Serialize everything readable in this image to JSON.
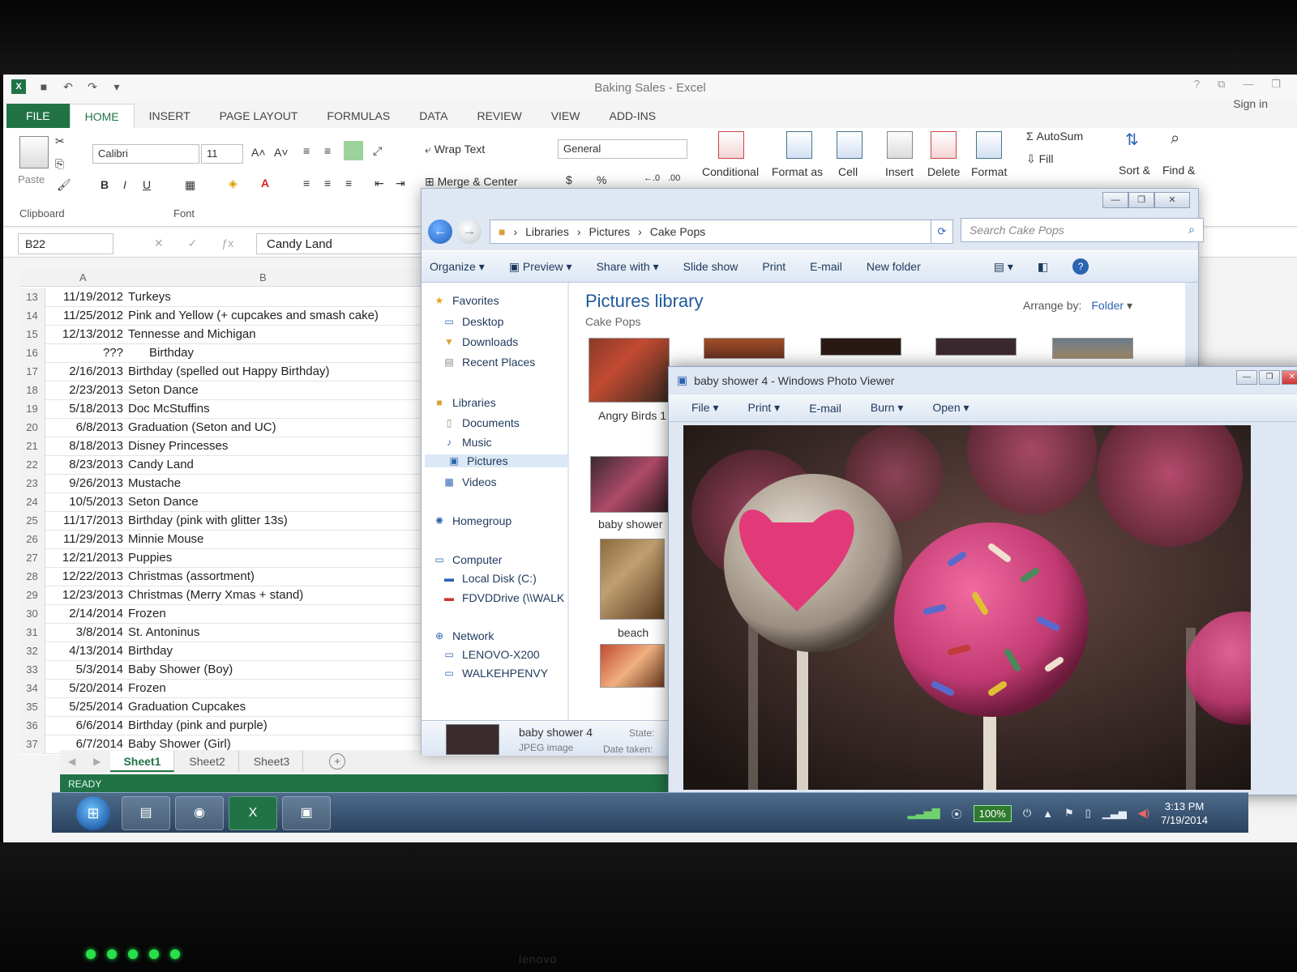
{
  "excel": {
    "title": "Baking Sales - Excel",
    "sign_in": "Sign in",
    "tabs": [
      "FILE",
      "HOME",
      "INSERT",
      "PAGE LAYOUT",
      "FORMULAS",
      "DATA",
      "REVIEW",
      "VIEW",
      "ADD-INS"
    ],
    "ribbon": {
      "paste": "Paste",
      "clipboard": "Clipboard",
      "font_group": "Font",
      "font_name": "Calibri",
      "font_size": "11",
      "bold": "B",
      "italic": "I",
      "underline": "U",
      "wrap_text": "Wrap Text",
      "merge_center": "Merge & Center",
      "number_format": "General",
      "currency": "$",
      "percent": "%",
      "conditional": "Conditional",
      "format_as": "Format as",
      "cell": "Cell",
      "insert": "Insert",
      "delete": "Delete",
      "format": "Format",
      "autosum": "AutoSum",
      "fill": "Fill",
      "sort": "Sort &",
      "find": "Find &"
    },
    "name_box": "B22",
    "formula_value": "Candy Land",
    "columns": [
      "A",
      "B"
    ],
    "rows": [
      {
        "n": "13",
        "a": "11/19/2012",
        "b": "Turkeys"
      },
      {
        "n": "14",
        "a": "11/25/2012",
        "b": "Pink and Yellow (+ cupcakes and smash cake)"
      },
      {
        "n": "15",
        "a": "12/13/2012",
        "b": "Tennesse and Michigan"
      },
      {
        "n": "16",
        "a": "???",
        "b": "Birthday"
      },
      {
        "n": "17",
        "a": "2/16/2013",
        "b": "Birthday (spelled out Happy Birthday)"
      },
      {
        "n": "18",
        "a": "2/23/2013",
        "b": "Seton Dance"
      },
      {
        "n": "19",
        "a": "5/18/2013",
        "b": "Doc McStuffins"
      },
      {
        "n": "20",
        "a": "6/8/2013",
        "b": "Graduation (Seton and UC)"
      },
      {
        "n": "21",
        "a": "8/18/2013",
        "b": "Disney Princesses"
      },
      {
        "n": "22",
        "a": "8/23/2013",
        "b": "Candy Land"
      },
      {
        "n": "23",
        "a": "9/26/2013",
        "b": "Mustache"
      },
      {
        "n": "24",
        "a": "10/5/2013",
        "b": "Seton Dance"
      },
      {
        "n": "25",
        "a": "11/17/2013",
        "b": "Birthday (pink with glitter 13s)"
      },
      {
        "n": "26",
        "a": "11/29/2013",
        "b": "Minnie Mouse"
      },
      {
        "n": "27",
        "a": "12/21/2013",
        "b": "Puppies"
      },
      {
        "n": "28",
        "a": "12/22/2013",
        "b": "Christmas (assortment)"
      },
      {
        "n": "29",
        "a": "12/23/2013",
        "b": "Christmas (Merry Xmas + stand)"
      },
      {
        "n": "30",
        "a": "2/14/2014",
        "b": "Frozen"
      },
      {
        "n": "31",
        "a": "3/8/2014",
        "b": "St. Antoninus"
      },
      {
        "n": "32",
        "a": "4/13/2014",
        "b": "Birthday"
      },
      {
        "n": "33",
        "a": "5/3/2014",
        "b": "Baby Shower (Boy)"
      },
      {
        "n": "34",
        "a": "5/20/2014",
        "b": "Frozen"
      },
      {
        "n": "35",
        "a": "5/25/2014",
        "b": "Graduation Cupcakes"
      },
      {
        "n": "36",
        "a": "6/6/2014",
        "b": "Birthday (pink and purple)"
      },
      {
        "n": "37",
        "a": "6/7/2014",
        "b": "Baby Shower (Girl)"
      }
    ],
    "sheets": [
      "Sheet1",
      "Sheet2",
      "Sheet3"
    ],
    "status": "READY"
  },
  "explorer": {
    "breadcrumb": [
      "Libraries",
      "Pictures",
      "Cake Pops"
    ],
    "search_placeholder": "Search Cake Pops",
    "commands": [
      "Organize",
      "Preview",
      "Share with",
      "Slide show",
      "Print",
      "E-mail",
      "New folder"
    ],
    "nav": {
      "favorites": "Favorites",
      "desktop": "Desktop",
      "downloads": "Downloads",
      "recent": "Recent Places",
      "libraries": "Libraries",
      "documents": "Documents",
      "music": "Music",
      "pictures": "Pictures",
      "videos": "Videos",
      "homegroup": "Homegroup",
      "computer": "Computer",
      "local_disk": "Local Disk (C:)",
      "fdvd": "FDVDDrive (\\\\WALK",
      "network": "Network",
      "lenovo": "LENOVO-X200",
      "walkeh": "WALKEHPENVY"
    },
    "library_title": "Pictures library",
    "library_sub": "Cake Pops",
    "arrange_label": "Arrange by:",
    "arrange_value": "Folder",
    "thumbs": [
      "Angry Birds 1",
      "baby shower",
      "beach"
    ],
    "details": {
      "name": "baby shower 4",
      "type": "JPEG image",
      "state": "State:",
      "date": "Date taken:"
    }
  },
  "photo_viewer": {
    "title": "baby shower 4 - Windows Photo Viewer",
    "menu": [
      "File",
      "Print",
      "E-mail",
      "Burn",
      "Open"
    ]
  },
  "taskbar": {
    "battery": "100%",
    "time": "3:13 PM",
    "date": "7/19/2014"
  },
  "brand": "lenovo",
  "colors": {
    "excel_green": "#217346",
    "explorer_blue": "#1e5a9a",
    "cake_pink": "#d9437f"
  }
}
